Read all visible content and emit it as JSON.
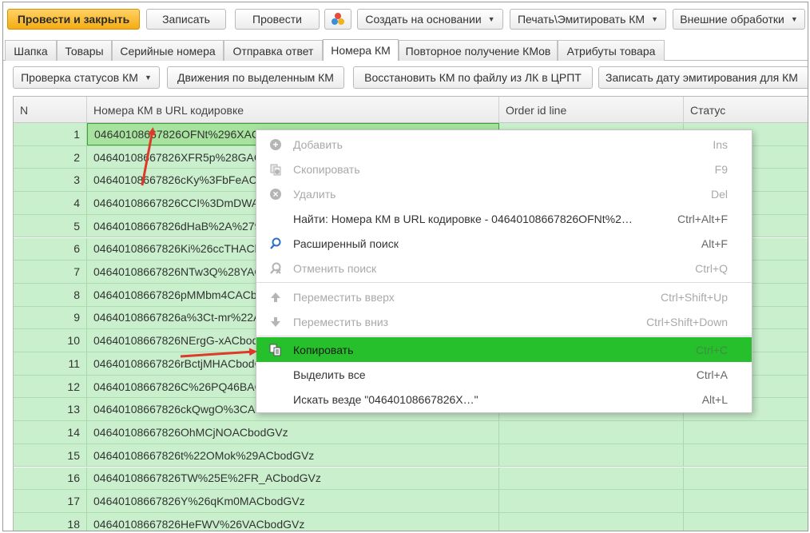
{
  "toolbar": {
    "post_close": "Провести и закрыть",
    "save": "Записать",
    "post": "Провести",
    "create_based": "Создать на основании",
    "print_emit": "Печать\\Эмитировать КМ",
    "external": "Внешние обработки"
  },
  "tabs": [
    {
      "label": "Шапка"
    },
    {
      "label": "Товары"
    },
    {
      "label": "Серийные номера"
    },
    {
      "label": "Отправка ответ"
    },
    {
      "label": "Номера КМ"
    },
    {
      "label": "Повторное получение КМов"
    },
    {
      "label": "Атрибуты товара"
    }
  ],
  "actions": {
    "check_status": "Проверка статусов КМ",
    "movements": "Движения по выделенным КМ",
    "restore": "Восстановить КМ по файлу из ЛК в ЦРПТ",
    "write_date": "Записать дату эмитирования для КМ"
  },
  "grid": {
    "columns": [
      "N",
      "Номера КМ в URL кодировке",
      "Order id line",
      "Статус"
    ],
    "rows": [
      {
        "n": "1",
        "km": "04640108667826OFNt%296XACbodGVz"
      },
      {
        "n": "2",
        "km": "04640108667826XFR5p%28GACbodGVz"
      },
      {
        "n": "3",
        "km": "04640108667826cKy%3FbFeACbodGVz"
      },
      {
        "n": "4",
        "km": "04640108667826CCI%3DmDWACbodGVz"
      },
      {
        "n": "5",
        "km": "04640108667826dHaB%2A%279ACbodGVz"
      },
      {
        "n": "6",
        "km": "04640108667826Ki%26ccTHACbodGVz"
      },
      {
        "n": "7",
        "km": "04640108667826NTw3Q%28YACbodGVz"
      },
      {
        "n": "8",
        "km": "04640108667826pMMbm4CACbodGVz"
      },
      {
        "n": "9",
        "km": "04640108667826a%3Ct-mr%22ACbodGVz"
      },
      {
        "n": "10",
        "km": "04640108667826NErgG-xACbodGVz"
      },
      {
        "n": "11",
        "km": "04640108667826rBctjMHACbodGVz"
      },
      {
        "n": "12",
        "km": "04640108667826C%26PQ46BACbodGVz"
      },
      {
        "n": "13",
        "km": "04640108667826ckQwgO%3CACbodGVz"
      },
      {
        "n": "14",
        "km": "04640108667826OhMCjNOACbodGVz"
      },
      {
        "n": "15",
        "km": "04640108667826t%22OMok%29ACbodGVz"
      },
      {
        "n": "16",
        "km": "04640108667826TW%25E%2FR_ACbodGVz"
      },
      {
        "n": "17",
        "km": "04640108667826Y%26qKm0MACbodGVz"
      },
      {
        "n": "18",
        "km": "04640108667826HeFWV%26VACbodGVz"
      }
    ]
  },
  "context_menu": {
    "items": [
      {
        "label": "Добавить",
        "shortcut": "Ins"
      },
      {
        "label": "Скопировать",
        "shortcut": "F9"
      },
      {
        "label": "Удалить",
        "shortcut": "Del"
      },
      {
        "label": "Найти: Номера КМ в URL кодировке - 04640108667826OFNt%2…",
        "shortcut": "Ctrl+Alt+F"
      },
      {
        "label": "Расширенный поиск",
        "shortcut": "Alt+F"
      },
      {
        "label": "Отменить поиск",
        "shortcut": "Ctrl+Q"
      },
      {
        "label": "Переместить вверх",
        "shortcut": "Ctrl+Shift+Up"
      },
      {
        "label": "Переместить вниз",
        "shortcut": "Ctrl+Shift+Down"
      },
      {
        "label": "Копировать",
        "shortcut": "Ctrl+C"
      },
      {
        "label": "Выделить все",
        "shortcut": "Ctrl+A"
      },
      {
        "label": "Искать везде \"04640108667826X…\"",
        "shortcut": "Alt+L"
      }
    ]
  },
  "colors": {
    "primary_button": "#f5ac12",
    "row_bg": "#c9efcc",
    "menu_highlight": "#26c02c",
    "arrow": "#e0392a"
  },
  "icons": [
    "add-icon",
    "copy-icon",
    "delete-icon",
    "search-icon",
    "cancel-search-icon",
    "arrow-up-icon",
    "arrow-down-icon",
    "copy-clipboard-icon",
    "color-dots-icon",
    "chevron-down-icon"
  ]
}
